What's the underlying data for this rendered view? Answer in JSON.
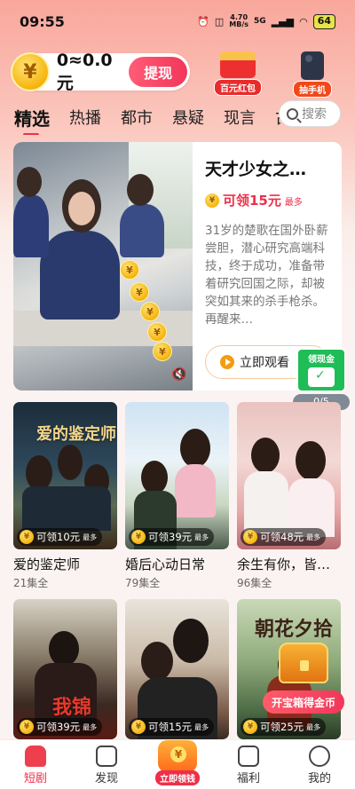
{
  "status_bar": {
    "time": "09:55",
    "net_speed": "4.70",
    "net_unit": "MB/s",
    "signal": "5G",
    "battery": "64"
  },
  "header": {
    "coin_symbol": "¥",
    "balance": "0≈0.0元",
    "withdraw_label": "提现",
    "redpack_label": "百元红包",
    "phone_label": "抽手机"
  },
  "tabs": [
    "精选",
    "热播",
    "都市",
    "悬疑",
    "现言",
    "古"
  ],
  "search": {
    "placeholder": "搜索"
  },
  "featured": {
    "title": "天才少女之…",
    "reward": "可领15元",
    "reward_suffix": "最多",
    "description": "31岁的楚歌在国外卧薪尝胆，潜心研究高端科技，终于成功，准备带着研究回国之际，却被突如其来的杀手枪杀。再醒来…",
    "watch_label": "立即观看",
    "poster_coin": "¥"
  },
  "cash_widget": {
    "label": "领现金",
    "progress": "0/5"
  },
  "dramas": [
    {
      "name": "爱的鉴定师",
      "episodes": "21集全",
      "reward": "可领10元",
      "suffix": "最多",
      "cover_text": "爱的鉴定师"
    },
    {
      "name": "婚后心动日常",
      "episodes": "79集全",
      "reward": "可领39元",
      "suffix": "最多",
      "cover_text": ""
    },
    {
      "name": "余生有你，皆…",
      "episodes": "96集全",
      "reward": "可领48元",
      "suffix": "最多",
      "cover_text": ""
    },
    {
      "name": "",
      "episodes": "",
      "reward": "可领39元",
      "suffix": "最多",
      "cover_text": "我锦"
    },
    {
      "name": "",
      "episodes": "",
      "reward": "可领15元",
      "suffix": "最多",
      "cover_text": ""
    },
    {
      "name": "",
      "episodes": "",
      "reward": "可领25元",
      "suffix": "最多",
      "cover_text": "朝花夕拾"
    }
  ],
  "chest": {
    "label": "开宝箱得金币"
  },
  "bottom_nav": [
    {
      "label": "短剧",
      "active": true
    },
    {
      "label": "发现",
      "active": false
    },
    {
      "label": "立即领钱",
      "active": false
    },
    {
      "label": "福利",
      "active": false
    },
    {
      "label": "我的",
      "active": false
    }
  ],
  "colors": {
    "accent": "#ee2f4a",
    "coin": "#f6b40c",
    "cash_green": "#1ebd56"
  }
}
